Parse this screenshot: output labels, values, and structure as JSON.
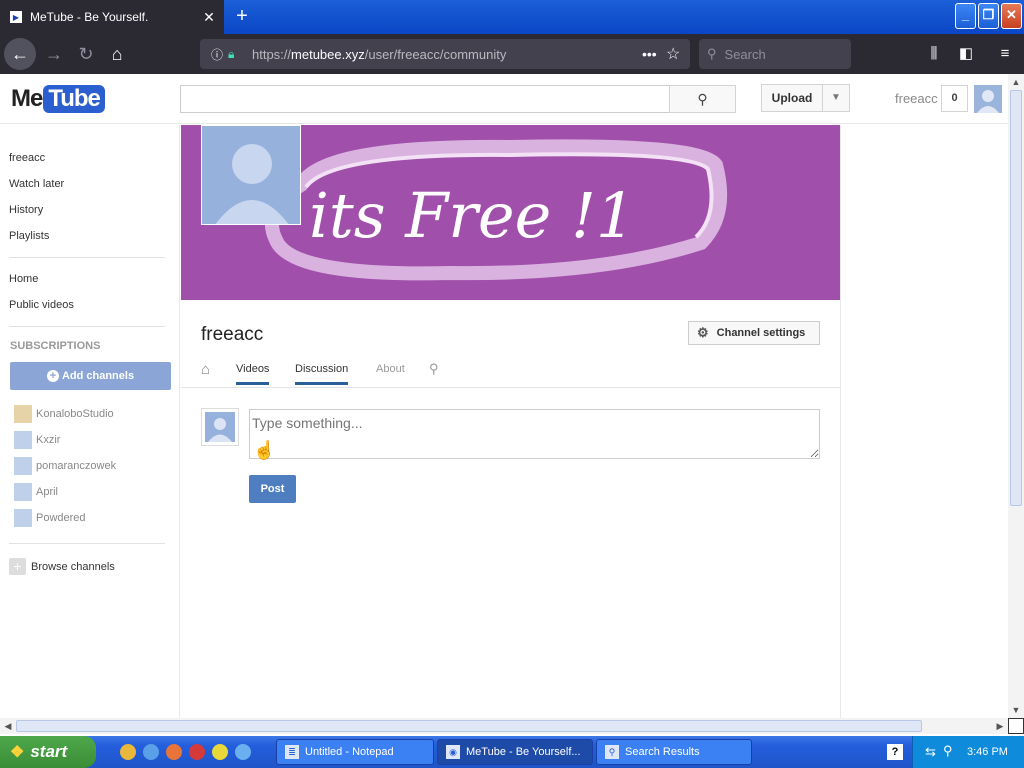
{
  "browser": {
    "tab_title": "MeTube - Be Yourself.",
    "tab_close": "✕",
    "new_tab": "+",
    "url_prefix": "https://",
    "url_host": "metubee.xyz",
    "url_path": "/user/freeacc/community",
    "search_placeholder": "Search"
  },
  "site": {
    "logo_me": "Me",
    "logo_tube": "Tube",
    "search_value": "",
    "upload_label": "Upload",
    "username": "freeacc",
    "notification_count": "0"
  },
  "sidebar": {
    "top_links": [
      "freeacc",
      "Watch later",
      "History",
      "Playlists"
    ],
    "mid_links": [
      "Home",
      "Public videos"
    ],
    "subscriptions_heading": "SUBSCRIPTIONS",
    "add_channels_label": "Add channels",
    "subscriptions": [
      "KonaloboStudio",
      "Kxzir",
      "pomaranczowek",
      "April",
      "Powdered"
    ],
    "browse_label": "Browse channels"
  },
  "channel": {
    "banner_text": "its Free !1",
    "name": "freeacc",
    "settings_label": "Channel settings",
    "tabs": [
      "Videos",
      "Discussion",
      "About"
    ],
    "active_tabs": [
      "Videos",
      "Discussion"
    ]
  },
  "comment": {
    "placeholder": "Type something...",
    "post_label": "Post"
  },
  "taskbar": {
    "start_label": "start",
    "tasks": [
      "Untitled - Notepad",
      "MeTube - Be Yourself...",
      "Search Results"
    ],
    "active_task": "MeTube - Be Yourself...",
    "clock": "3:46 PM"
  },
  "colors": {
    "banner": "#a050aa",
    "accent_blue": "#2b5fd0",
    "tab_underline": "#2b5f98",
    "taskbar": "#245edb"
  }
}
